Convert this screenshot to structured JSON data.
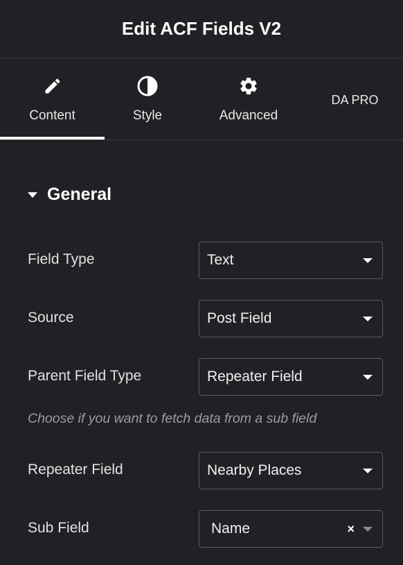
{
  "header": {
    "title": "Edit ACF Fields V2"
  },
  "tabs": [
    {
      "label": "Content",
      "icon": "pencil-icon",
      "active": true
    },
    {
      "label": "Style",
      "icon": "contrast-icon",
      "active": false
    },
    {
      "label": "Advanced",
      "icon": "gear-icon",
      "active": false
    },
    {
      "label": "DA PRO",
      "icon": "",
      "active": false
    }
  ],
  "section": {
    "title": "General",
    "expanded": true
  },
  "fields": {
    "field_type": {
      "label": "Field Type",
      "value": "Text"
    },
    "source": {
      "label": "Source",
      "value": "Post Field"
    },
    "parent_field_type": {
      "label": "Parent Field Type",
      "value": "Repeater Field"
    },
    "help_text": "Choose if you want to fetch data from a sub field",
    "repeater_field": {
      "label": "Repeater Field",
      "value": "Nearby Places"
    },
    "sub_field": {
      "label": "Sub Field",
      "value": "Name",
      "clear_symbol": "×"
    }
  },
  "colors": {
    "background": "#202124",
    "text": "#e6e6e6",
    "border": "#5a5b60",
    "muted_text": "#9a9ca2",
    "active_tab_indicator": "#ffffff"
  }
}
